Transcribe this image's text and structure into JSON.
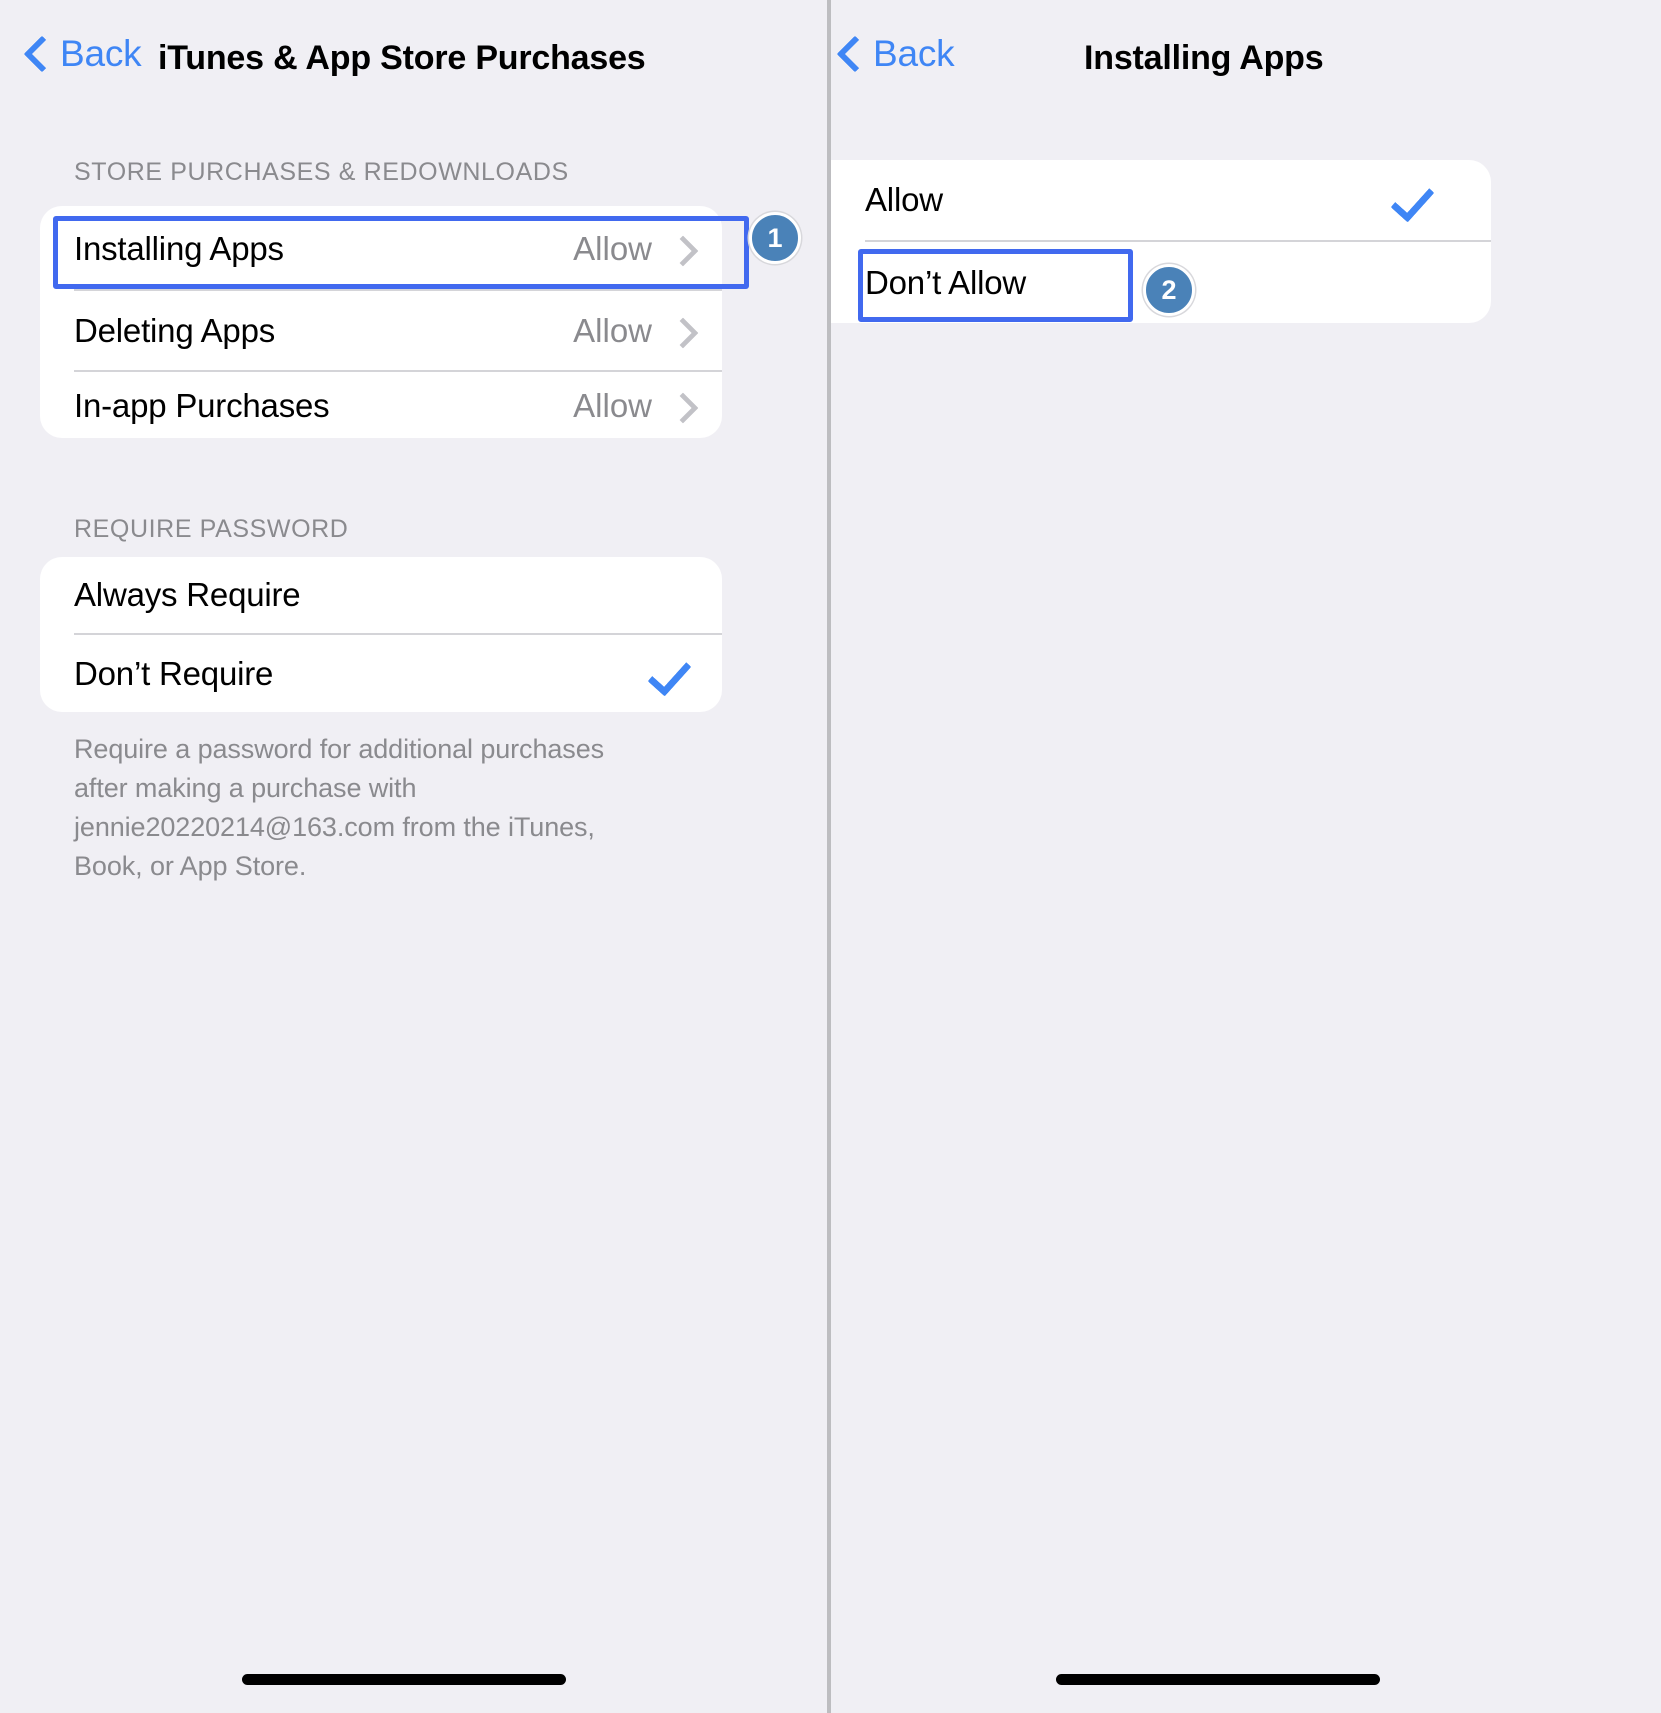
{
  "left_panel": {
    "nav": {
      "back_label": "Back",
      "back_icon": "chevron-left-icon",
      "title": "iTunes & App Store Purchases"
    },
    "section1": {
      "header": "STORE PURCHASES & REDOWNLOADS",
      "rows": [
        {
          "label": "Installing Apps",
          "value": "Allow",
          "accessory": "chevron-right-icon"
        },
        {
          "label": "Deleting Apps",
          "value": "Allow",
          "accessory": "chevron-right-icon"
        },
        {
          "label": "In-app Purchases",
          "value": "Allow",
          "accessory": "chevron-right-icon"
        }
      ]
    },
    "section2": {
      "header": "REQUIRE PASSWORD",
      "rows": [
        {
          "label": "Always Require",
          "checked": false
        },
        {
          "label": "Don’t Require",
          "checked": true
        }
      ],
      "footer_note": "Require a password for additional purchases after making a purchase with jennie20220214@163.com from the iTunes, Book, or App Store."
    },
    "annotation": {
      "badge": "1"
    }
  },
  "right_panel": {
    "nav": {
      "back_label": "Back",
      "back_icon": "chevron-left-icon",
      "title": "Installing Apps"
    },
    "options": [
      {
        "label": "Allow",
        "checked": true
      },
      {
        "label": "Don’t Allow",
        "checked": false
      }
    ],
    "annotation": {
      "badge": "2"
    }
  },
  "colors": {
    "background": "#f0eff4",
    "card": "#ffffff",
    "accent_blue": "#3f86f5",
    "highlight_box": "#4169ef",
    "badge_fill": "#4a82b8",
    "secondary_text": "#8a8a8e",
    "separator": "#d4d4d8",
    "divider": "#bdbdc0"
  }
}
